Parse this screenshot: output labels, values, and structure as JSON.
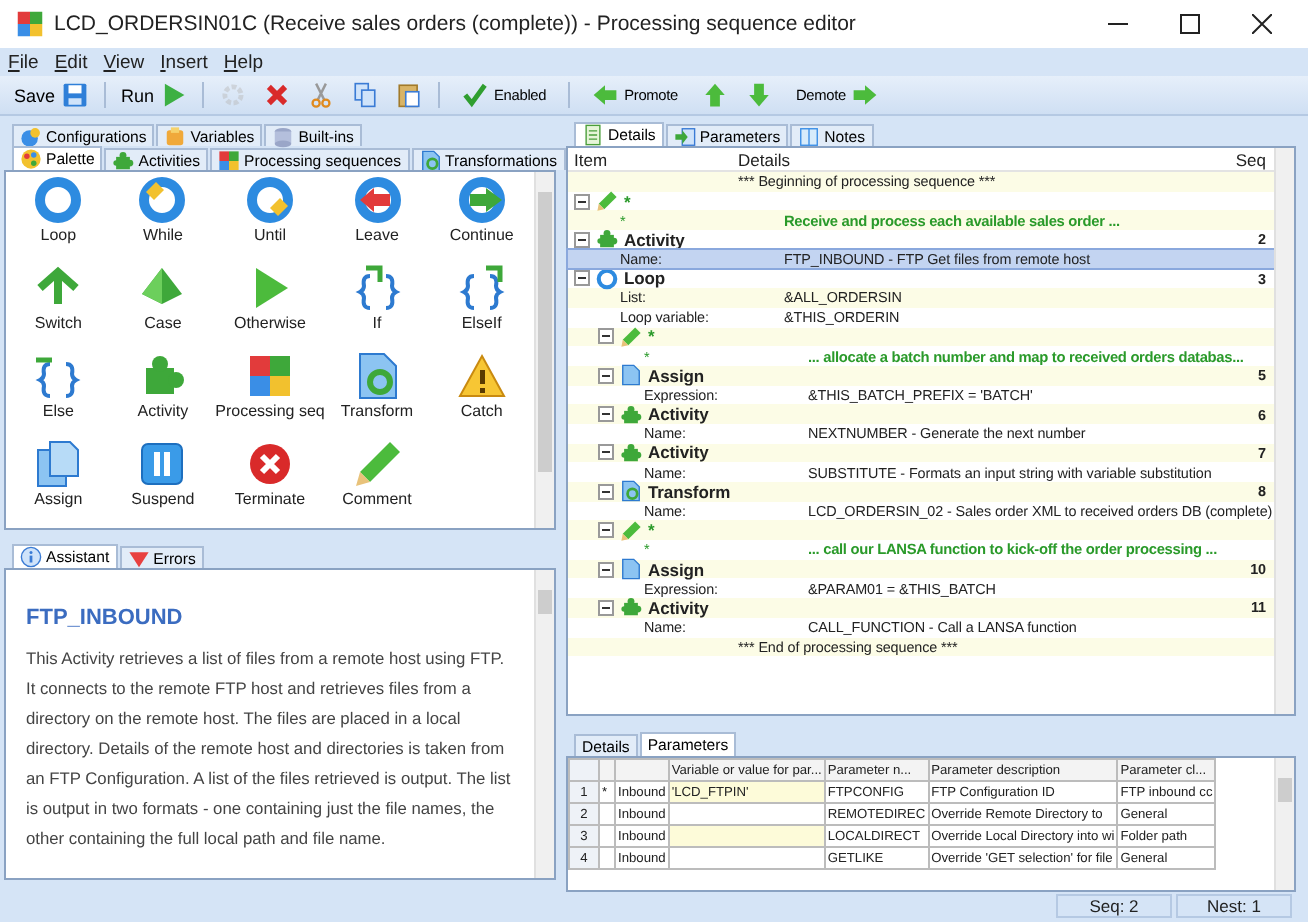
{
  "window": {
    "title": "LCD_ORDERSIN01C (Receive sales orders (complete)) - Processing sequence editor"
  },
  "menu": [
    "File",
    "Edit",
    "View",
    "Insert",
    "Help"
  ],
  "toolbar": {
    "save": "Save",
    "run": "Run",
    "edit_tools": [
      {
        "disabled": true
      },
      {
        "disabled": false
      },
      {
        "disabled": false
      },
      {
        "disabled": false
      },
      {
        "disabled": false
      }
    ],
    "enabled": "Enabled",
    "promote": "Promote",
    "demote": "Demote"
  },
  "left_tabs_top": [
    {
      "label": "Configurations",
      "selected": false
    },
    {
      "label": "Variables",
      "selected": false
    },
    {
      "label": "Built-ins",
      "selected": false
    }
  ],
  "left_tabs": [
    {
      "label": "Palette",
      "selected": true
    },
    {
      "label": "Activities",
      "selected": false
    },
    {
      "label": "Processing sequences",
      "selected": false
    },
    {
      "label": "Transformations",
      "selected": false
    }
  ],
  "palette": [
    "Loop",
    "While",
    "Until",
    "Leave",
    "Continue",
    "Switch",
    "Case",
    "Otherwise",
    "If",
    "ElseIf",
    "Else",
    "Activity",
    "Processing seq",
    "Transform",
    "Catch",
    "Assign",
    "Suspend",
    "Terminate",
    "Comment"
  ],
  "assistant_tabs": [
    {
      "label": "Assistant",
      "selected": true
    },
    {
      "label": "Errors",
      "selected": false
    }
  ],
  "assistant": {
    "title": "FTP_INBOUND",
    "text": "This Activity retrieves a list of files from a remote host using FTP. It connects to the remote FTP host and retrieves files from a directory on the remote host. The files are placed in a local directory. Details of the remote host and directories is taken from an FTP Configuration. A list of the files retrieved is output. The list is output in two formats - one containing just the file names, the other containing the full local path and file name."
  },
  "right_tabs": [
    {
      "label": "Details",
      "selected": true
    },
    {
      "label": "Parameters",
      "selected": false
    },
    {
      "label": "Notes",
      "selected": false
    }
  ],
  "tree": {
    "columns": [
      "Item",
      "Details",
      "Seq"
    ],
    "items": [
      {
        "kind": "marker",
        "details": "*** Beginning of processing sequence ***"
      },
      {
        "kind": "comment",
        "item": "*",
        "expanded": true,
        "properties": [
          {
            "label": "*",
            "value": "Receive and process each available sales order ...",
            "selected": false
          }
        ]
      },
      {
        "kind": "activity",
        "item": "Activity",
        "seq": "2",
        "expanded": true,
        "properties": [
          {
            "label": "Name:",
            "value": "FTP_INBOUND - FTP Get files from remote host",
            "selected": true
          }
        ]
      },
      {
        "kind": "loop",
        "item": "Loop",
        "seq": "3",
        "expanded": true,
        "properties": [
          {
            "label": "List:",
            "value": "&ALL_ORDERSIN",
            "selected": false
          },
          {
            "label": "Loop variable:",
            "value": "&THIS_ORDERIN",
            "selected": false
          }
        ],
        "children": [
          {
            "kind": "comment",
            "item": "*",
            "expanded": true,
            "properties": [
              {
                "label": "*",
                "value": "... allocate a batch number and map to received orders databas...",
                "selected": false
              }
            ]
          },
          {
            "kind": "assign",
            "item": "Assign",
            "seq": "5",
            "expanded": true,
            "properties": [
              {
                "label": "Expression:",
                "value": "&THIS_BATCH_PREFIX = 'BATCH'",
                "selected": false
              }
            ]
          },
          {
            "kind": "activity",
            "item": "Activity",
            "seq": "6",
            "expanded": true,
            "properties": [
              {
                "label": "Name:",
                "value": "NEXTNUMBER - Generate the next number",
                "selected": false
              }
            ]
          },
          {
            "kind": "activity",
            "item": "Activity",
            "seq": "7",
            "expanded": true,
            "properties": [
              {
                "label": "Name:",
                "value": "SUBSTITUTE - Formats an input string with variable substitution",
                "selected": false
              }
            ]
          },
          {
            "kind": "transform",
            "item": "Transform",
            "seq": "8",
            "expanded": true,
            "properties": [
              {
                "label": "Name:",
                "value": "LCD_ORDERSIN_02 - Sales order XML to received orders DB (complete)",
                "selected": false
              }
            ]
          },
          {
            "kind": "comment",
            "item": "*",
            "expanded": true,
            "properties": [
              {
                "label": "*",
                "value": "... call our LANSA function to kick-off the order processing ...",
                "selected": false
              }
            ]
          },
          {
            "kind": "assign",
            "item": "Assign",
            "seq": "10",
            "expanded": true,
            "properties": [
              {
                "label": "Expression:",
                "value": "&PARAM01 = &THIS_BATCH",
                "selected": false
              }
            ]
          },
          {
            "kind": "activity",
            "item": "Activity",
            "seq": "11",
            "expanded": true,
            "properties": [
              {
                "label": "Name:",
                "value": "CALL_FUNCTION - Call a LANSA function",
                "selected": false
              }
            ]
          }
        ]
      },
      {
        "kind": "marker",
        "details": "*** End of processing sequence ***"
      }
    ]
  },
  "bottom_tabs": [
    {
      "label": "Details",
      "selected": false
    },
    {
      "label": "Parameters",
      "selected": true
    }
  ],
  "parameters": {
    "columns": [
      "Variable or value for par...",
      "Parameter n...",
      "Parameter description",
      "Parameter cl..."
    ],
    "rows": [
      {
        "number": "1",
        "marker": "*",
        "direction": "Inbound",
        "value": "'LCD_FTPIN'",
        "name": "FTPCONFIG",
        "description": "FTP Configuration ID",
        "class": "FTP inbound cc"
      },
      {
        "number": "2",
        "direction": "Inbound",
        "name": "REMOTEDIREC",
        "description": "Override Remote Directory to",
        "class": "General"
      },
      {
        "number": "3",
        "direction": "Inbound",
        "name": "LOCALDIRECT",
        "description": "Override Local Directory into wi",
        "class": "Folder path"
      },
      {
        "number": "4",
        "direction": "Inbound",
        "name": "GETLIKE",
        "description": "Override 'GET selection' for file",
        "class": "General"
      }
    ]
  },
  "status_bar": [
    "Seq: 2",
    "Nest: 1"
  ]
}
